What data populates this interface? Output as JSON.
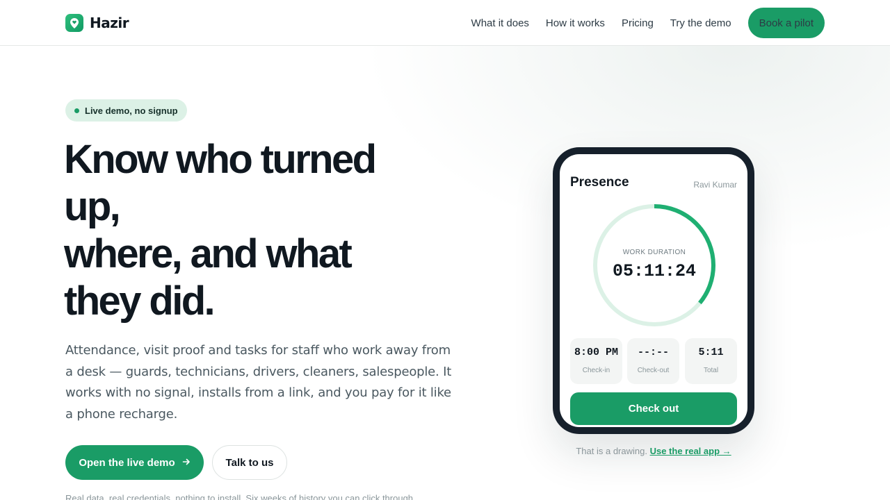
{
  "brand": {
    "name": "Hazir",
    "logo_icon": "map-pin-heart-icon",
    "accent": "#1a9c66",
    "ink": "#101820"
  },
  "nav": {
    "links": [
      "What it does",
      "How it works",
      "Pricing",
      "Try the demo"
    ],
    "cta": "Book a pilot"
  },
  "hero": {
    "badge": "Live demo, no signup",
    "title_lines": [
      "Know who turned",
      "up,",
      "where, and what",
      "they did."
    ],
    "lede": "Attendance, visit proof and tasks for staff who work away from a desk — guards, technicians, drivers, cleaners, salespeople. It works with no signal, installs from a link, and you pay for it like a phone recharge.",
    "primary_cta": "Open the live demo",
    "primary_cta_icon": "arrow-right-icon",
    "secondary_cta": "Talk to us",
    "fine_print": "Real data, real credentials, nothing to install. Six weeks of history you can click through."
  },
  "phone": {
    "title": "Presence",
    "user": "Ravi Kumar",
    "ring_label": "WORK DURATION",
    "ring_value": "05:11:24",
    "ring_progress": 0.36,
    "stats": [
      {
        "value": "8:00 PM",
        "label": "Check-in"
      },
      {
        "value": "--:--",
        "label": "Check-out"
      },
      {
        "value": "5:11",
        "label": "Total"
      }
    ],
    "button": "Check out"
  },
  "caption": {
    "text": "That is a drawing.",
    "link": "Use the real app →"
  }
}
